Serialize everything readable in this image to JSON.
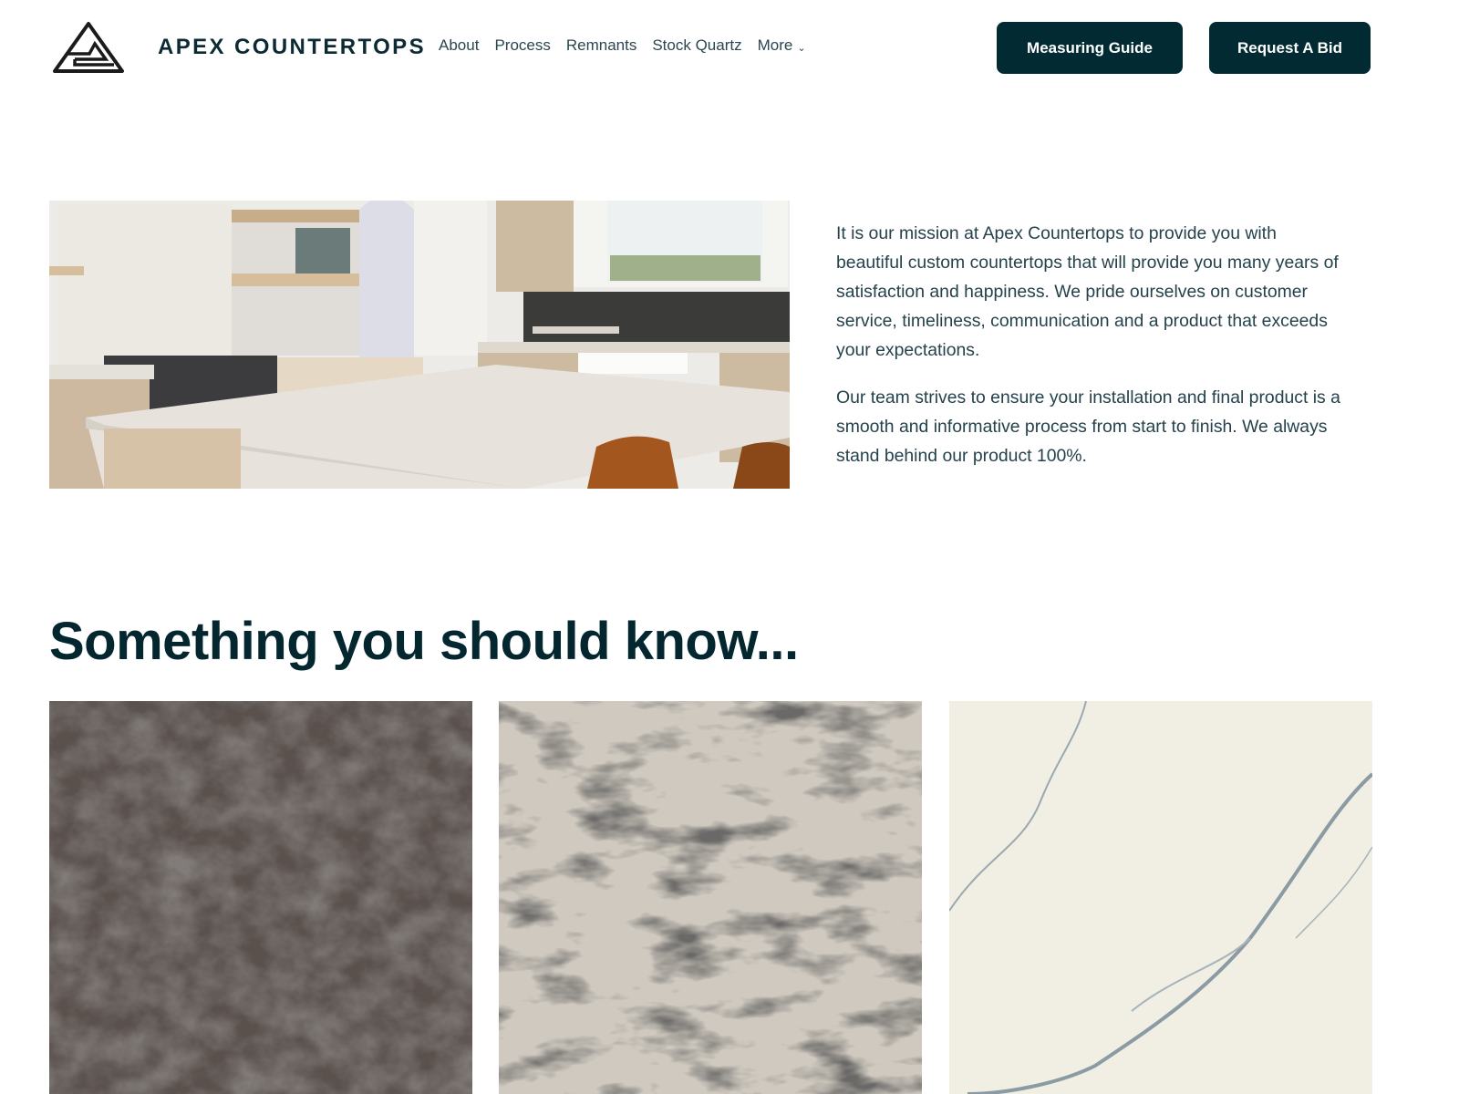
{
  "header": {
    "logo_icon": "apex-triangle-logo",
    "brand": "APEX COUNTERTOPS",
    "nav": [
      {
        "label": "About"
      },
      {
        "label": "Process"
      },
      {
        "label": "Remnants"
      },
      {
        "label": "Stock Quartz"
      },
      {
        "label": "More",
        "icon": "chevron-down-icon",
        "glyph": "⌄"
      }
    ],
    "buttons": {
      "measuring_guide": "Measuring Guide",
      "request_bid": "Request A Bid"
    }
  },
  "intro": {
    "image_alt": "Kitchen with white quartz island countertop",
    "paragraphs": [
      "It is our mission at Apex Countertops to provide you with beautiful custom countertops that will provide you many years of satisfaction and happiness.  We pride ourselves on customer service, timeliness, communication and a product that exceeds your expectations.",
      "Our team strives to ensure your installation and final product is a smooth and informative process from start to finish.  We always stand behind our product 100%."
    ]
  },
  "know": {
    "title": "Something you should know...",
    "tiles": [
      {
        "alt": "Dark brown swirled quartz sample"
      },
      {
        "alt": "Grey and white veined granite sample"
      },
      {
        "alt": "White quartz with grey veining sample"
      }
    ]
  },
  "colors": {
    "primary": "#022a33",
    "text": "#25424c",
    "heading": "#03262f"
  }
}
